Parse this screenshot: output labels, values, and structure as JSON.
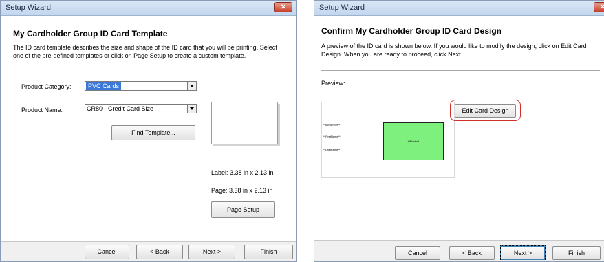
{
  "left_window": {
    "title": "Setup Wizard",
    "close": "✕",
    "header": "My Cardholder Group ID Card Template",
    "description": "The ID card template describes the size and shape of the ID card that you will be printing. Select one of the pre-defined templates or click on Page Setup to create a custom template.",
    "product_category_label": "Product Category:",
    "product_category_value": "PVC Cards",
    "product_name_label": "Product Name:",
    "product_name_value": "CR80 - Credit Card Size",
    "find_template_button": "Find Template...",
    "label_size": "Label: 3.38 in x 2.13 in",
    "page_size": "Page: 3.38 in x 2.13 in",
    "page_setup_button": "Page Setup",
    "buttons": {
      "cancel": "Cancel",
      "back": "< Back",
      "next": "Next >",
      "finish": "Finish"
    }
  },
  "right_window": {
    "title": "Setup Wizard",
    "close": "✕",
    "header": "Confirm My Cardholder Group ID Card Design",
    "description": "A preview of the ID card is shown below. If you would like to modify the design, click on Edit Card Design. When you are ready to proceed, click Next.",
    "preview_label": "Preview:",
    "card_fields": [
      "**IDNumber**",
      "**FirstName**",
      "**LastName**"
    ],
    "photo_text": "**Photo**",
    "edit_card_design_button": "Edit Card Design",
    "buttons": {
      "cancel": "Cancel",
      "back": "< Back",
      "next": "Next >",
      "finish": "Finish"
    }
  },
  "colors": {
    "selection": "#3b78d8",
    "photo_fill": "#7ef07e",
    "highlight": "#d0302a",
    "close_button": "#c7402a"
  }
}
